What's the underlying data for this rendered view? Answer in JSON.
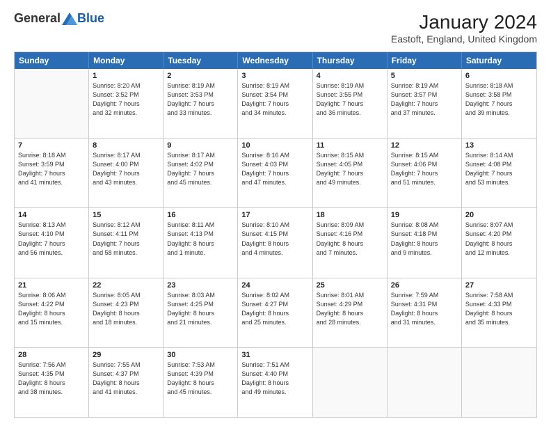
{
  "header": {
    "logo_general": "General",
    "logo_blue": "Blue",
    "title": "January 2024",
    "location": "Eastoft, England, United Kingdom"
  },
  "weekdays": [
    "Sunday",
    "Monday",
    "Tuesday",
    "Wednesday",
    "Thursday",
    "Friday",
    "Saturday"
  ],
  "weeks": [
    [
      {
        "day": "",
        "info": ""
      },
      {
        "day": "1",
        "info": "Sunrise: 8:20 AM\nSunset: 3:52 PM\nDaylight: 7 hours\nand 32 minutes."
      },
      {
        "day": "2",
        "info": "Sunrise: 8:19 AM\nSunset: 3:53 PM\nDaylight: 7 hours\nand 33 minutes."
      },
      {
        "day": "3",
        "info": "Sunrise: 8:19 AM\nSunset: 3:54 PM\nDaylight: 7 hours\nand 34 minutes."
      },
      {
        "day": "4",
        "info": "Sunrise: 8:19 AM\nSunset: 3:55 PM\nDaylight: 7 hours\nand 36 minutes."
      },
      {
        "day": "5",
        "info": "Sunrise: 8:19 AM\nSunset: 3:57 PM\nDaylight: 7 hours\nand 37 minutes."
      },
      {
        "day": "6",
        "info": "Sunrise: 8:18 AM\nSunset: 3:58 PM\nDaylight: 7 hours\nand 39 minutes."
      }
    ],
    [
      {
        "day": "7",
        "info": "Sunrise: 8:18 AM\nSunset: 3:59 PM\nDaylight: 7 hours\nand 41 minutes."
      },
      {
        "day": "8",
        "info": "Sunrise: 8:17 AM\nSunset: 4:00 PM\nDaylight: 7 hours\nand 43 minutes."
      },
      {
        "day": "9",
        "info": "Sunrise: 8:17 AM\nSunset: 4:02 PM\nDaylight: 7 hours\nand 45 minutes."
      },
      {
        "day": "10",
        "info": "Sunrise: 8:16 AM\nSunset: 4:03 PM\nDaylight: 7 hours\nand 47 minutes."
      },
      {
        "day": "11",
        "info": "Sunrise: 8:15 AM\nSunset: 4:05 PM\nDaylight: 7 hours\nand 49 minutes."
      },
      {
        "day": "12",
        "info": "Sunrise: 8:15 AM\nSunset: 4:06 PM\nDaylight: 7 hours\nand 51 minutes."
      },
      {
        "day": "13",
        "info": "Sunrise: 8:14 AM\nSunset: 4:08 PM\nDaylight: 7 hours\nand 53 minutes."
      }
    ],
    [
      {
        "day": "14",
        "info": "Sunrise: 8:13 AM\nSunset: 4:10 PM\nDaylight: 7 hours\nand 56 minutes."
      },
      {
        "day": "15",
        "info": "Sunrise: 8:12 AM\nSunset: 4:11 PM\nDaylight: 7 hours\nand 58 minutes."
      },
      {
        "day": "16",
        "info": "Sunrise: 8:11 AM\nSunset: 4:13 PM\nDaylight: 8 hours\nand 1 minute."
      },
      {
        "day": "17",
        "info": "Sunrise: 8:10 AM\nSunset: 4:15 PM\nDaylight: 8 hours\nand 4 minutes."
      },
      {
        "day": "18",
        "info": "Sunrise: 8:09 AM\nSunset: 4:16 PM\nDaylight: 8 hours\nand 7 minutes."
      },
      {
        "day": "19",
        "info": "Sunrise: 8:08 AM\nSunset: 4:18 PM\nDaylight: 8 hours\nand 9 minutes."
      },
      {
        "day": "20",
        "info": "Sunrise: 8:07 AM\nSunset: 4:20 PM\nDaylight: 8 hours\nand 12 minutes."
      }
    ],
    [
      {
        "day": "21",
        "info": "Sunrise: 8:06 AM\nSunset: 4:22 PM\nDaylight: 8 hours\nand 15 minutes."
      },
      {
        "day": "22",
        "info": "Sunrise: 8:05 AM\nSunset: 4:23 PM\nDaylight: 8 hours\nand 18 minutes."
      },
      {
        "day": "23",
        "info": "Sunrise: 8:03 AM\nSunset: 4:25 PM\nDaylight: 8 hours\nand 21 minutes."
      },
      {
        "day": "24",
        "info": "Sunrise: 8:02 AM\nSunset: 4:27 PM\nDaylight: 8 hours\nand 25 minutes."
      },
      {
        "day": "25",
        "info": "Sunrise: 8:01 AM\nSunset: 4:29 PM\nDaylight: 8 hours\nand 28 minutes."
      },
      {
        "day": "26",
        "info": "Sunrise: 7:59 AM\nSunset: 4:31 PM\nDaylight: 8 hours\nand 31 minutes."
      },
      {
        "day": "27",
        "info": "Sunrise: 7:58 AM\nSunset: 4:33 PM\nDaylight: 8 hours\nand 35 minutes."
      }
    ],
    [
      {
        "day": "28",
        "info": "Sunrise: 7:56 AM\nSunset: 4:35 PM\nDaylight: 8 hours\nand 38 minutes."
      },
      {
        "day": "29",
        "info": "Sunrise: 7:55 AM\nSunset: 4:37 PM\nDaylight: 8 hours\nand 41 minutes."
      },
      {
        "day": "30",
        "info": "Sunrise: 7:53 AM\nSunset: 4:39 PM\nDaylight: 8 hours\nand 45 minutes."
      },
      {
        "day": "31",
        "info": "Sunrise: 7:51 AM\nSunset: 4:40 PM\nDaylight: 8 hours\nand 49 minutes."
      },
      {
        "day": "",
        "info": ""
      },
      {
        "day": "",
        "info": ""
      },
      {
        "day": "",
        "info": ""
      }
    ]
  ]
}
